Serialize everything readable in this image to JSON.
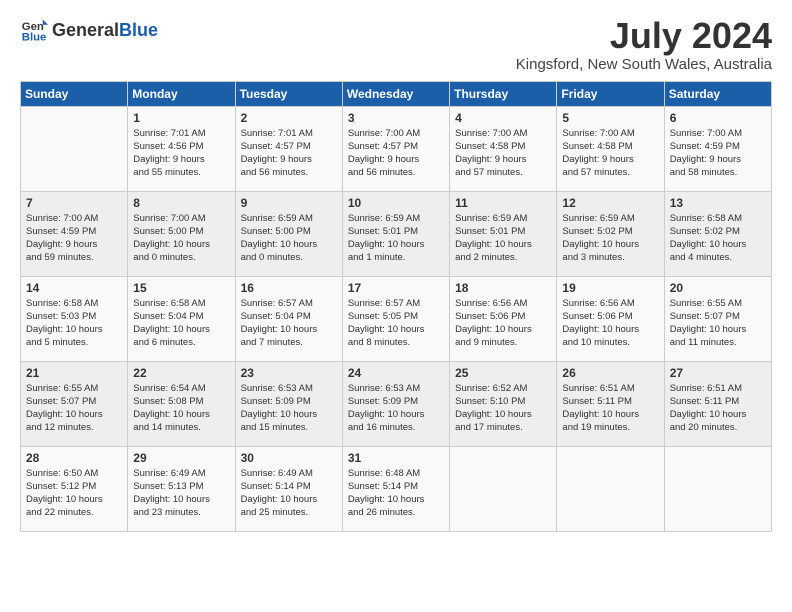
{
  "logo": {
    "general": "General",
    "blue": "Blue"
  },
  "title": "July 2024",
  "location": "Kingsford, New South Wales, Australia",
  "weekdays": [
    "Sunday",
    "Monday",
    "Tuesday",
    "Wednesday",
    "Thursday",
    "Friday",
    "Saturday"
  ],
  "weeks": [
    [
      {
        "day": "",
        "detail": ""
      },
      {
        "day": "1",
        "detail": "Sunrise: 7:01 AM\nSunset: 4:56 PM\nDaylight: 9 hours\nand 55 minutes."
      },
      {
        "day": "2",
        "detail": "Sunrise: 7:01 AM\nSunset: 4:57 PM\nDaylight: 9 hours\nand 56 minutes."
      },
      {
        "day": "3",
        "detail": "Sunrise: 7:00 AM\nSunset: 4:57 PM\nDaylight: 9 hours\nand 56 minutes."
      },
      {
        "day": "4",
        "detail": "Sunrise: 7:00 AM\nSunset: 4:58 PM\nDaylight: 9 hours\nand 57 minutes."
      },
      {
        "day": "5",
        "detail": "Sunrise: 7:00 AM\nSunset: 4:58 PM\nDaylight: 9 hours\nand 57 minutes."
      },
      {
        "day": "6",
        "detail": "Sunrise: 7:00 AM\nSunset: 4:59 PM\nDaylight: 9 hours\nand 58 minutes."
      }
    ],
    [
      {
        "day": "7",
        "detail": "Sunrise: 7:00 AM\nSunset: 4:59 PM\nDaylight: 9 hours\nand 59 minutes."
      },
      {
        "day": "8",
        "detail": "Sunrise: 7:00 AM\nSunset: 5:00 PM\nDaylight: 10 hours\nand 0 minutes."
      },
      {
        "day": "9",
        "detail": "Sunrise: 6:59 AM\nSunset: 5:00 PM\nDaylight: 10 hours\nand 0 minutes."
      },
      {
        "day": "10",
        "detail": "Sunrise: 6:59 AM\nSunset: 5:01 PM\nDaylight: 10 hours\nand 1 minute."
      },
      {
        "day": "11",
        "detail": "Sunrise: 6:59 AM\nSunset: 5:01 PM\nDaylight: 10 hours\nand 2 minutes."
      },
      {
        "day": "12",
        "detail": "Sunrise: 6:59 AM\nSunset: 5:02 PM\nDaylight: 10 hours\nand 3 minutes."
      },
      {
        "day": "13",
        "detail": "Sunrise: 6:58 AM\nSunset: 5:02 PM\nDaylight: 10 hours\nand 4 minutes."
      }
    ],
    [
      {
        "day": "14",
        "detail": "Sunrise: 6:58 AM\nSunset: 5:03 PM\nDaylight: 10 hours\nand 5 minutes."
      },
      {
        "day": "15",
        "detail": "Sunrise: 6:58 AM\nSunset: 5:04 PM\nDaylight: 10 hours\nand 6 minutes."
      },
      {
        "day": "16",
        "detail": "Sunrise: 6:57 AM\nSunset: 5:04 PM\nDaylight: 10 hours\nand 7 minutes."
      },
      {
        "day": "17",
        "detail": "Sunrise: 6:57 AM\nSunset: 5:05 PM\nDaylight: 10 hours\nand 8 minutes."
      },
      {
        "day": "18",
        "detail": "Sunrise: 6:56 AM\nSunset: 5:06 PM\nDaylight: 10 hours\nand 9 minutes."
      },
      {
        "day": "19",
        "detail": "Sunrise: 6:56 AM\nSunset: 5:06 PM\nDaylight: 10 hours\nand 10 minutes."
      },
      {
        "day": "20",
        "detail": "Sunrise: 6:55 AM\nSunset: 5:07 PM\nDaylight: 10 hours\nand 11 minutes."
      }
    ],
    [
      {
        "day": "21",
        "detail": "Sunrise: 6:55 AM\nSunset: 5:07 PM\nDaylight: 10 hours\nand 12 minutes."
      },
      {
        "day": "22",
        "detail": "Sunrise: 6:54 AM\nSunset: 5:08 PM\nDaylight: 10 hours\nand 14 minutes."
      },
      {
        "day": "23",
        "detail": "Sunrise: 6:53 AM\nSunset: 5:09 PM\nDaylight: 10 hours\nand 15 minutes."
      },
      {
        "day": "24",
        "detail": "Sunrise: 6:53 AM\nSunset: 5:09 PM\nDaylight: 10 hours\nand 16 minutes."
      },
      {
        "day": "25",
        "detail": "Sunrise: 6:52 AM\nSunset: 5:10 PM\nDaylight: 10 hours\nand 17 minutes."
      },
      {
        "day": "26",
        "detail": "Sunrise: 6:51 AM\nSunset: 5:11 PM\nDaylight: 10 hours\nand 19 minutes."
      },
      {
        "day": "27",
        "detail": "Sunrise: 6:51 AM\nSunset: 5:11 PM\nDaylight: 10 hours\nand 20 minutes."
      }
    ],
    [
      {
        "day": "28",
        "detail": "Sunrise: 6:50 AM\nSunset: 5:12 PM\nDaylight: 10 hours\nand 22 minutes."
      },
      {
        "day": "29",
        "detail": "Sunrise: 6:49 AM\nSunset: 5:13 PM\nDaylight: 10 hours\nand 23 minutes."
      },
      {
        "day": "30",
        "detail": "Sunrise: 6:49 AM\nSunset: 5:14 PM\nDaylight: 10 hours\nand 25 minutes."
      },
      {
        "day": "31",
        "detail": "Sunrise: 6:48 AM\nSunset: 5:14 PM\nDaylight: 10 hours\nand 26 minutes."
      },
      {
        "day": "",
        "detail": ""
      },
      {
        "day": "",
        "detail": ""
      },
      {
        "day": "",
        "detail": ""
      }
    ]
  ]
}
